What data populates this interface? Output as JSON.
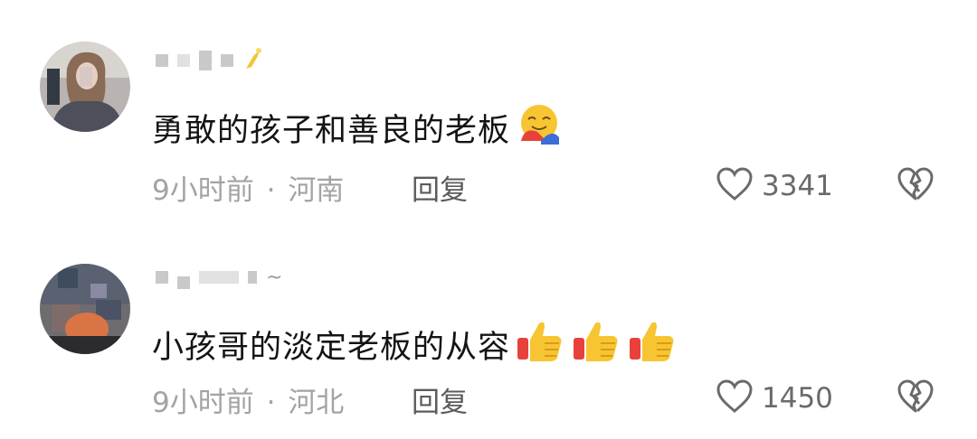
{
  "comments": [
    {
      "username_visible": "",
      "text": "勇敢的孩子和善良的老板",
      "emojis": [
        "smiling-face-with-hearts-hugging-icon"
      ],
      "time": "9小时前",
      "separator": "·",
      "location": "河南",
      "reply_label": "回复",
      "likes": "3341"
    },
    {
      "username_visible": "~",
      "text": "小孩哥的淡定老板的从容",
      "emojis": [
        "thumbs-up-icon",
        "thumbs-up-icon",
        "thumbs-up-icon"
      ],
      "time": "9小时前",
      "separator": "·",
      "location": "河北",
      "reply_label": "回复",
      "likes": "1450"
    }
  ],
  "colors": {
    "text": "#141414",
    "meta": "#a3a3a3",
    "reply": "#5b5b5b",
    "icon": "#6a6a6a",
    "emoji_yellow": "#f7c531",
    "emoji_red": "#e8413c"
  }
}
